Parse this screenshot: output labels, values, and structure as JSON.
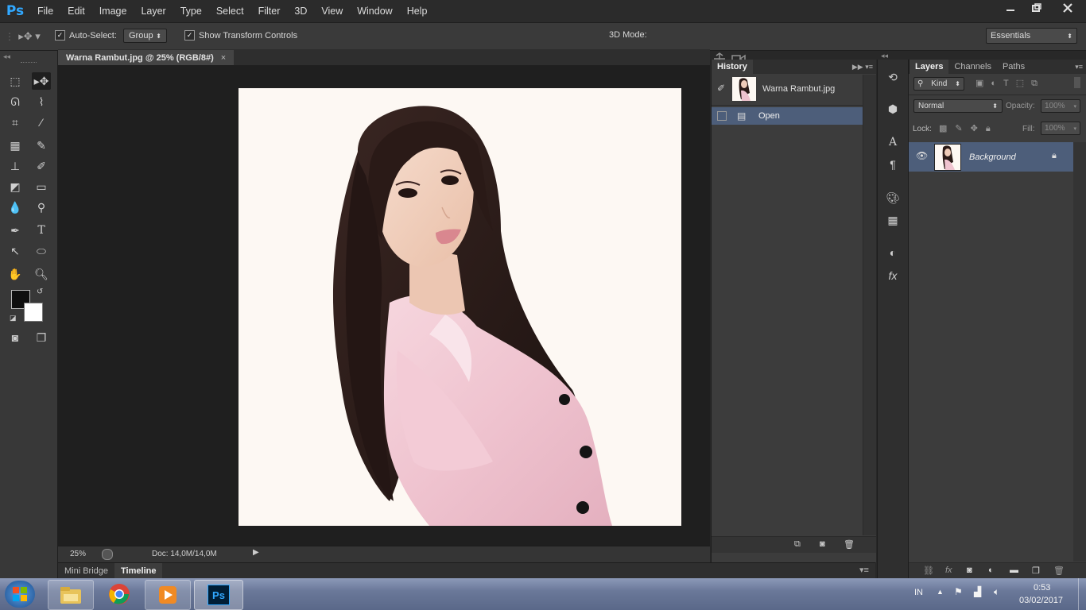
{
  "app": {
    "logo": "Ps",
    "menu": [
      "File",
      "Edit",
      "Image",
      "Layer",
      "Type",
      "Select",
      "Filter",
      "3D",
      "View",
      "Window",
      "Help"
    ],
    "window_controls": [
      "minimize",
      "restore",
      "close"
    ]
  },
  "options": {
    "auto_select_label": "Auto-Select:",
    "auto_select_checked": true,
    "group_value": "Group",
    "show_transform_label": "Show Transform Controls",
    "show_transform_checked": true,
    "mode_3d_label": "3D Mode:",
    "workspace": "Essentials"
  },
  "document": {
    "tab_title": "Warna Rambut.jpg @ 25% (RGB/8#)",
    "zoom": "25%",
    "doc_size": "Doc: 14,0M/14,0M"
  },
  "history": {
    "title": "History",
    "snapshot": "Warna Rambut.jpg",
    "states": [
      "Open"
    ]
  },
  "layers": {
    "tabs": [
      "Layers",
      "Channels",
      "Paths"
    ],
    "filter_kind": "Kind",
    "blend_mode": "Normal",
    "opacity_label": "Opacity:",
    "opacity": "100%",
    "lock_label": "Lock:",
    "fill_label": "Fill:",
    "fill": "100%",
    "items": [
      {
        "name": "Background",
        "visible": true,
        "locked": true
      }
    ]
  },
  "bottom_tabs": [
    "Mini Bridge",
    "Timeline"
  ],
  "taskbar": {
    "lang": "IN",
    "time": "0:53",
    "date": "03/02/2017"
  }
}
